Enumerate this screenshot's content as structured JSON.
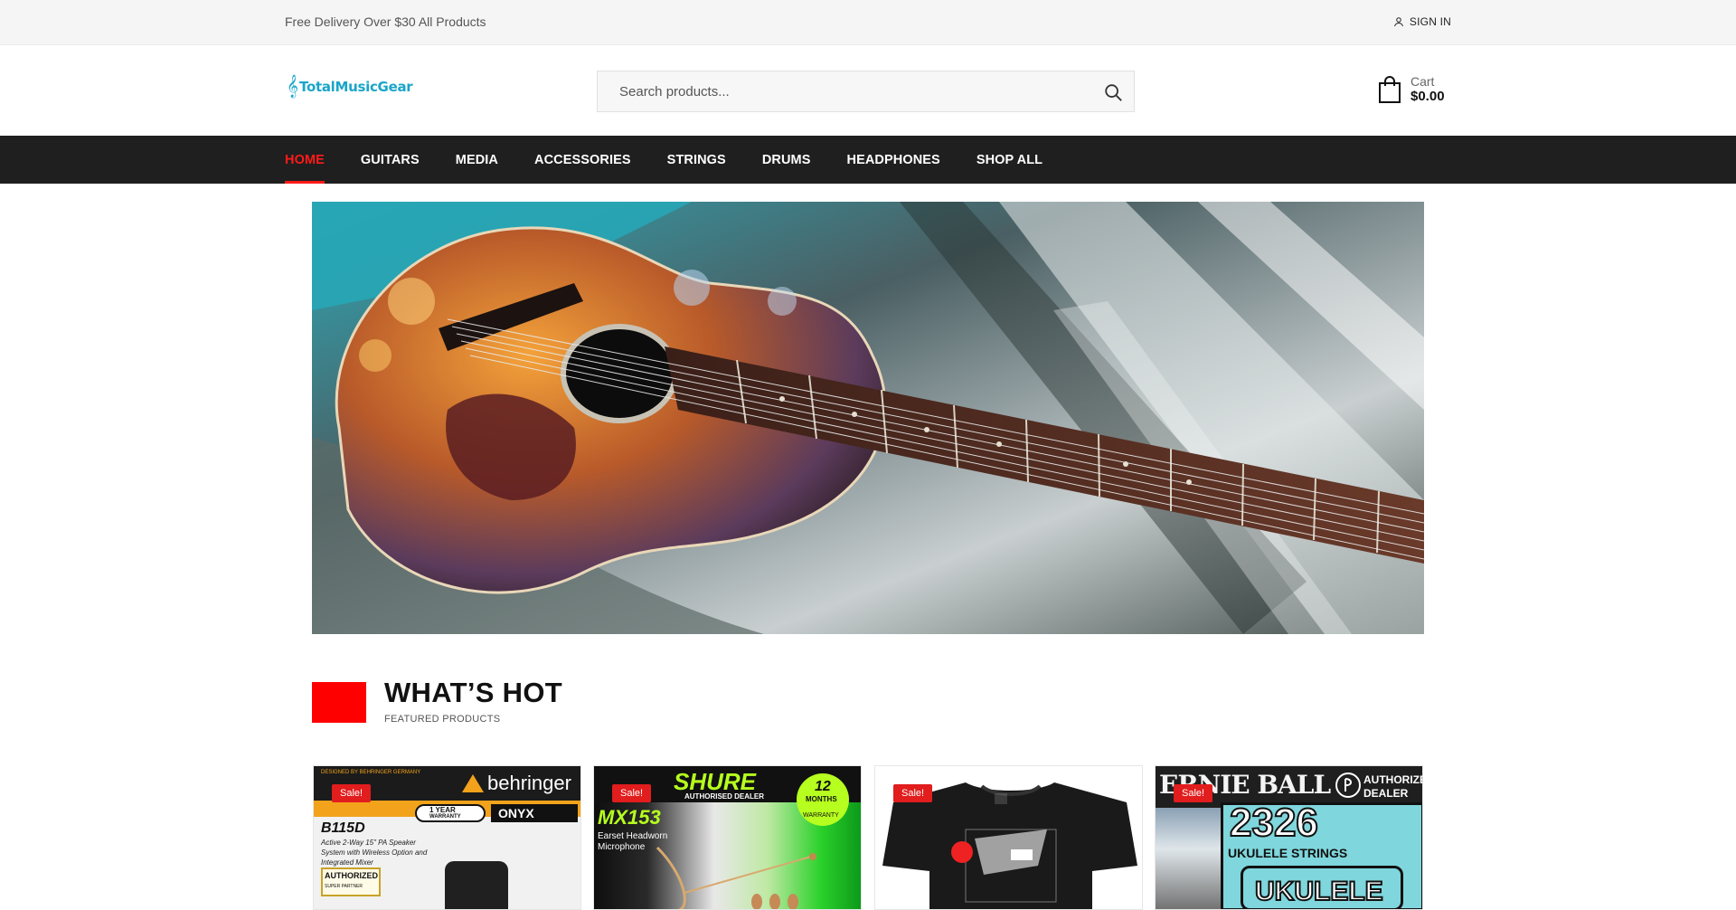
{
  "topbar": {
    "promo": "Free Delivery Over $30 All Products",
    "signin_label": "SIGN IN",
    "signin_icon": "user-icon"
  },
  "header": {
    "logo_text": "TotalMusicGear",
    "logo_icon": "treble-clef-icon",
    "search_placeholder": "Search products...",
    "search_icon": "search-icon",
    "cart_label": "Cart",
    "cart_total": "$0.00",
    "cart_icon": "shopping-bag-icon"
  },
  "nav": {
    "items": [
      {
        "label": "HOME",
        "active": true
      },
      {
        "label": "GUITARS"
      },
      {
        "label": "MEDIA"
      },
      {
        "label": "ACCESSORIES"
      },
      {
        "label": "STRINGS"
      },
      {
        "label": "DRUMS"
      },
      {
        "label": "HEADPHONES"
      },
      {
        "label": "SHOP ALL"
      }
    ],
    "accent": "#ff1a1a"
  },
  "section": {
    "title": "WHAT’S HOT",
    "subtitle": "FEATURED PRODUCTS",
    "accent": "#ff0000"
  },
  "products": [
    {
      "badge": "Sale!",
      "brand": "behringer",
      "tagline": "DESIGNED BY BEHRINGER GERMANY",
      "model": "B115D",
      "desc_1": "Active 2-Way 15\" PA Speaker",
      "desc_2": "System with Wireless Option and",
      "desc_3": "Integrated Mixer",
      "warranty": "1 YEAR",
      "warranty_2": "WARRANTY",
      "onyx": "ONYX",
      "partner_1": "AUTHORIZED",
      "partner_2": "SUPER PARTNER"
    },
    {
      "badge": "Sale!",
      "brand": "SHURE",
      "dealer": "AUTHORISED DEALER",
      "model": "MX153",
      "desc_1": "Earset Headworn",
      "desc_2": "Microphone",
      "months": "12",
      "months_label": "MONTHS",
      "warranty": "WARRANTY"
    },
    {
      "badge": "Sale!"
    },
    {
      "badge": "Sale!",
      "brand": "ERNIE BALL",
      "dealer_1": "AUTHORIZED",
      "dealer_2": "DEALER",
      "model": "2326",
      "desc": "UKULELE STRINGS",
      "pack_text": "UKULELE"
    }
  ],
  "colors": {
    "topbar_bg": "#f5f5f5",
    "nav_bg": "#1f1f1f",
    "logo": "#1aa6c8",
    "sale_badge": "#e11d1d"
  }
}
